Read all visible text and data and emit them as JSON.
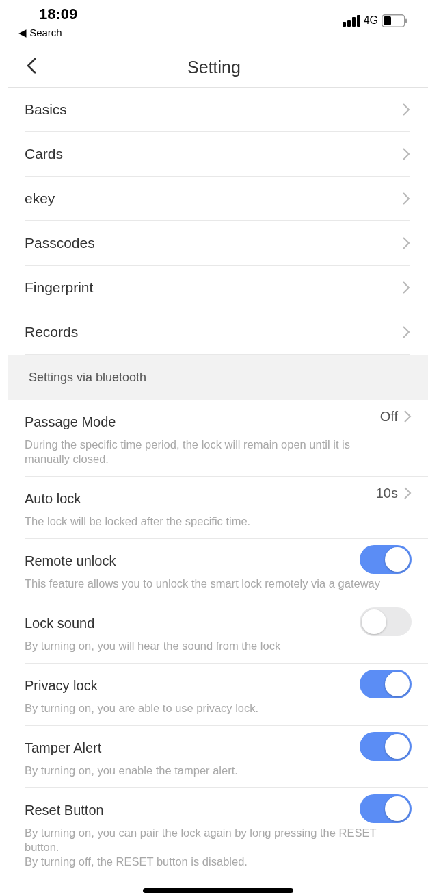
{
  "status_bar": {
    "time": "18:09",
    "back_app": "◀ Search",
    "network": "4G"
  },
  "nav": {
    "title": "Setting"
  },
  "menu": [
    {
      "label": "Basics"
    },
    {
      "label": "Cards"
    },
    {
      "label": "ekey"
    },
    {
      "label": "Passcodes"
    },
    {
      "label": "Fingerprint"
    },
    {
      "label": "Records"
    }
  ],
  "section_header": "Settings via bluetooth",
  "settings": [
    {
      "kind": "link",
      "title": "Passage Mode",
      "value": "Off",
      "description": "During the specific time period, the lock will remain open until it is manually closed."
    },
    {
      "kind": "link",
      "title": "Auto lock",
      "value": "10s",
      "description": "The lock will be locked after the specific time."
    },
    {
      "kind": "toggle",
      "title": "Remote unlock",
      "on": true,
      "description": "This feature allows you to unlock the smart lock remotely via a gateway"
    },
    {
      "kind": "toggle",
      "title": "Lock sound",
      "on": false,
      "description": "By turning on, you will hear the sound from the lock"
    },
    {
      "kind": "toggle",
      "title": "Privacy lock",
      "on": true,
      "description": "By turning on, you are able to use privacy lock."
    },
    {
      "kind": "toggle",
      "title": "Tamper Alert",
      "on": true,
      "description": "By turning on, you enable the tamper alert."
    },
    {
      "kind": "toggle",
      "title": "Reset Button",
      "on": true,
      "description": "By turning on, you can pair the lock again by long pressing the RESET button.\nBy turning off, the RESET button is disabled."
    }
  ]
}
